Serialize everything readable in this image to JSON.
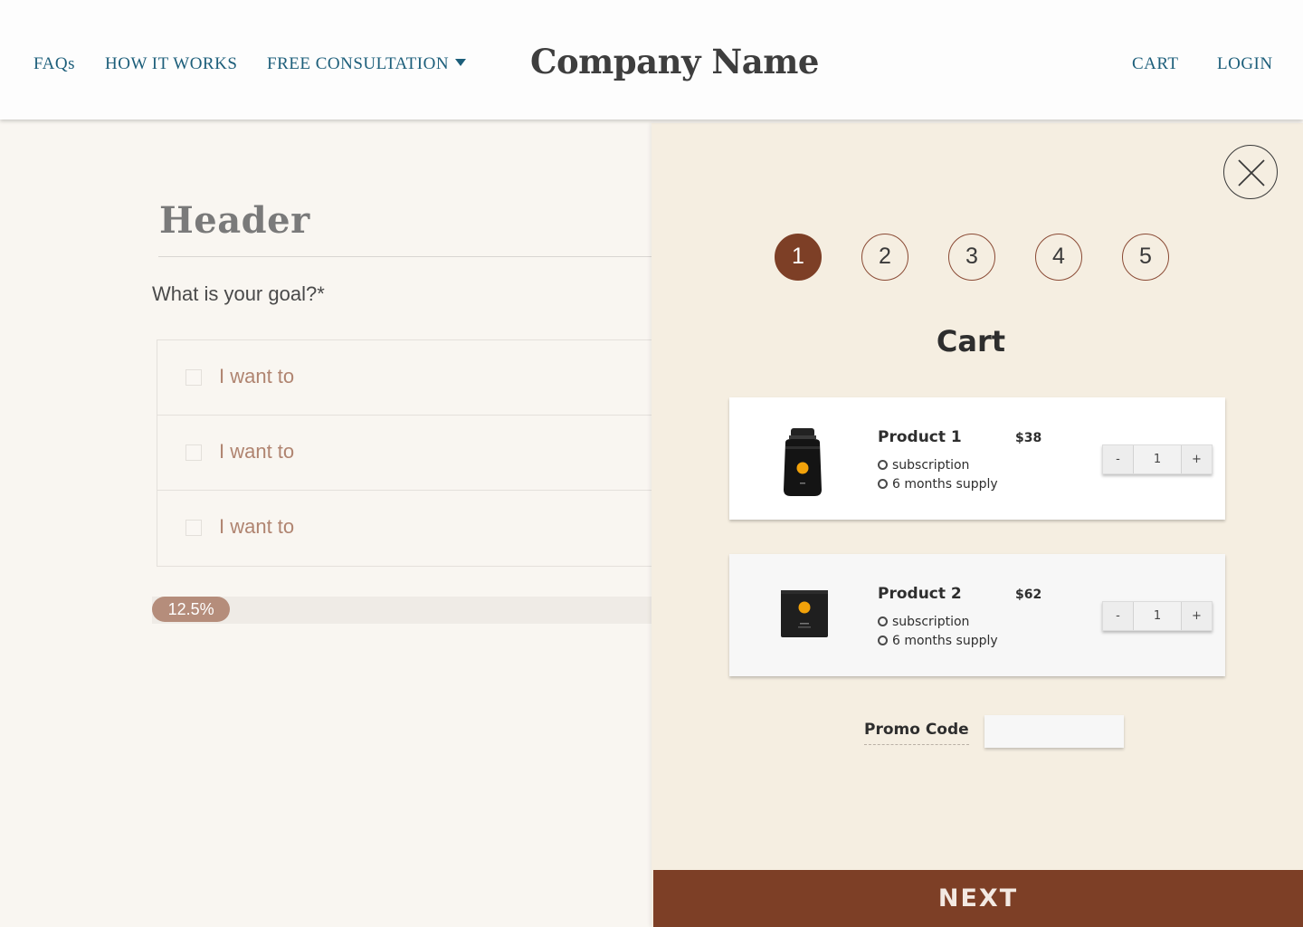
{
  "nav": {
    "faqs": "FAQs",
    "how_it_works": "HOW IT WORKS",
    "free_consultation": "FREE CONSULTATION",
    "brand": "Company Name",
    "cart": "CART",
    "login": "LOGIN"
  },
  "form": {
    "header": "Header",
    "question": "What is your goal?*",
    "options": [
      {
        "label": "I want to",
        "checked": false
      },
      {
        "label": "I want to",
        "checked": false
      },
      {
        "label": "I want to",
        "checked": false
      }
    ],
    "progress_label": "12.5%",
    "progress_value": 0.125
  },
  "cart": {
    "steps": [
      "1",
      "2",
      "3",
      "4",
      "5"
    ],
    "active_step": 1,
    "title": "Cart",
    "products": [
      {
        "name": "Product 1",
        "price": "$38",
        "option_1": "subscription",
        "option_2": "6 months supply",
        "quantity": "1",
        "image_icon": "jar-icon"
      },
      {
        "name": "Product 2",
        "price": "$62",
        "option_1": "subscription",
        "option_2": "6 months supply",
        "quantity": "1",
        "image_icon": "pouch-icon"
      }
    ],
    "minus": "-",
    "plus": "+",
    "promo_label": "Promo Code",
    "promo_value": "",
    "next": "NEXT"
  },
  "colors": {
    "accent": "#7d3f26",
    "link": "#1c5e7a",
    "progress": "#b58d7b",
    "cart_bg": "#f5eee1"
  }
}
